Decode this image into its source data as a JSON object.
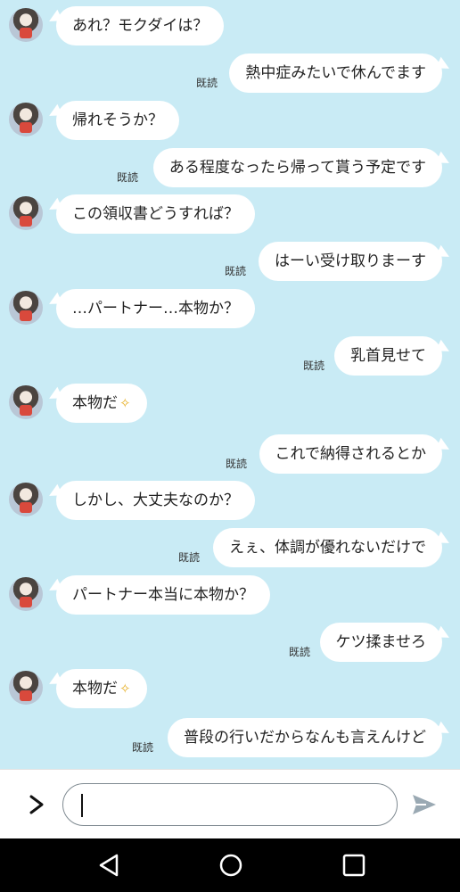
{
  "read_label": "既読",
  "sparkle_icon": "sparkle-icon",
  "messages": [
    {
      "side": "in",
      "text": "あれ？モクダイは？"
    },
    {
      "side": "out",
      "text": "熱中症みたいで休んでます"
    },
    {
      "side": "in",
      "text": "帰れそうか？"
    },
    {
      "side": "out",
      "text": "ある程度なったら帰って貰う予定です"
    },
    {
      "side": "in",
      "text": "この領収書どうすれば？"
    },
    {
      "side": "out",
      "text": "はーい受け取りまーす"
    },
    {
      "side": "in",
      "text": "…パートナー…本物か？"
    },
    {
      "side": "out",
      "text": "乳首見せて"
    },
    {
      "side": "in",
      "text": "本物だ",
      "sparkle": true
    },
    {
      "side": "out",
      "text": "これで納得されるとか"
    },
    {
      "side": "in",
      "text": "しかし、大丈夫なのか？"
    },
    {
      "side": "out",
      "text": "えぇ、体調が優れないだけで"
    },
    {
      "side": "in",
      "text": "パートナー本当に本物か？"
    },
    {
      "side": "out",
      "text": "ケツ揉ませろ"
    },
    {
      "side": "in",
      "text": "本物だ",
      "sparkle": true
    },
    {
      "side": "out",
      "text": "普段の行いだからなんも言えんけど"
    }
  ],
  "input": {
    "value": "",
    "placeholder": ""
  },
  "colors": {
    "background": "#c9ebf5",
    "bubble": "#ffffff",
    "send_icon": "#9aa9b3",
    "nav_bar": "#000000"
  }
}
